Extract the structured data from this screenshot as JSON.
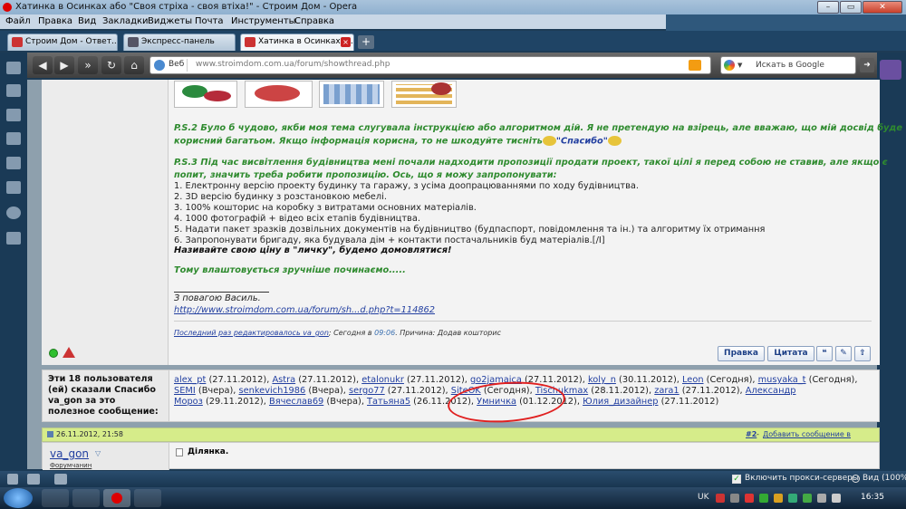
{
  "window": {
    "title": "Хатинка в Осинках або \"Своя стріха - своя втіха!\" - Строим Дом - Opera"
  },
  "menu": [
    "Файл",
    "Правка",
    "Вид",
    "Закладки",
    "Виджеты",
    "Почта",
    "Инструменты",
    "Справка"
  ],
  "tabs": [
    {
      "label": "Строим Дом - Ответ..."
    },
    {
      "label": "Экспресс-панель"
    },
    {
      "label": "Хатинка в Осинках а..."
    }
  ],
  "addressbar": {
    "mode": "Веб",
    "url": "www.stroimdom.com.ua/forum/showthread.php",
    "search_placeholder": "Искать в Google"
  },
  "post": {
    "ps2": "P.S.2 Було б чудово, якби моя тема слугувала інструкцією або алгоритмом дій. Я не претендую на взірець, але вважаю, що мій досвід буде",
    "ps2_line2": "корисний багатьом. Якщо інформація корисна, то не шкодуйте тисніть",
    "ps2_thanks": "\"Спасибо\"",
    "ps3": "P.S.3 Під час висвітлення будівництва мені почали надходити пропозиції продати проект, такої цілі я перед собою не ставив, але якщо є",
    "ps3_line2": "попит, значить треба робити пропозицію. Ось, що я можу запропонувати:",
    "items": [
      "1. Електронну версію проекту будинку та гаражу, з усіма доопрацюваннями по ходу будівництва.",
      "2. 3D версію будинку з розстановкою мебелі.",
      "3. 100% кошторис на коробку з витратами основних матеріалів.",
      "4. 1000 фотографій + відео всіх етапів будівництва.",
      "5. Надати пакет зразків дозвільних документів на будівництво (будпаспорт, повідомлення та ін.) та алгоритму їх отримання",
      "6. Запропонувати бригаду, яка будувала дім + контакти постачальників буд матеріалів.[/I]"
    ],
    "price_call": "Називайте свою ціну в \"личку\", будемо домовлятися!",
    "convenient": "Тому влаштовується зручніше починаємо.....",
    "signature_greeting": "З повагою Василь.",
    "signature_link": "http://www.stroimdom.com.ua/forum/sh...d.php?t=114862",
    "edit_link": "Последний раз редактировалось va_gon",
    "edit_rest": "; Сегодня в",
    "edit_time": "09:06",
    "edit_reason": ". Причина: Додав кошторис",
    "btn_edit": "Правка",
    "btn_quote": "Цитата"
  },
  "thanks": {
    "header": "Эти 18 пользователя (ей) сказали Спасибо va_gon за это полезное сообщение:",
    "line1": [
      {
        "user": "alex_pt",
        "date": " (27.11.2012), "
      },
      {
        "user": "Astra",
        "date": " (27.11.2012), "
      },
      {
        "user": "etalonukr",
        "date": " (27.11.2012), "
      },
      {
        "user": "go2jamaica",
        "date": " (27.11.2012), "
      },
      {
        "user": "koly_n",
        "date": " (30.11.2012), "
      },
      {
        "user": "Leon",
        "date": " (Сегодня), "
      },
      {
        "user": "musyaka_t",
        "date": " (Сегодня),"
      }
    ],
    "line2": [
      {
        "user": "SEMI",
        "date": " (Вчера), "
      },
      {
        "user": "senkevich1986",
        "date": " (Вчера), "
      },
      {
        "user": "sergo77",
        "date": " (27.11.2012), "
      },
      {
        "user": "SiteOK",
        "date": " (Сегодня), "
      },
      {
        "user": "Tischukmax",
        "date": " (28.11.2012), "
      },
      {
        "user": "zara1",
        "date": " (27.11.2012), "
      },
      {
        "user": "Александр",
        "date": ""
      }
    ],
    "line3": [
      {
        "user": "Мороз",
        "date": " (29.11.2012), "
      },
      {
        "user": "Вячеслав69",
        "date": " (Вчера), "
      },
      {
        "user": "Татьяна5",
        "date": " (26.11.2012), "
      },
      {
        "user": "Умничка",
        "date": " (01.12.2012), "
      },
      {
        "user": "Юлия_дизайнер",
        "date": " (27.11.2012)"
      }
    ]
  },
  "next_post": {
    "date": "26.11.2012, 21:58",
    "number": "#2",
    "bookmark": "Добавить сообщение в закладки",
    "author": "va_gon",
    "role": "Форумчанин",
    "title": "Ділянка."
  },
  "status": {
    "proxy": "Включить прокси-серверы",
    "zoom": "Вид (100%)"
  },
  "taskbar": {
    "lang": "UK",
    "time": "16:35"
  },
  "colors": {
    "green_text": "#2f8b2f",
    "link": "#223fa0",
    "annotation": "#e02020",
    "post_bar": "#d6ec8a"
  }
}
